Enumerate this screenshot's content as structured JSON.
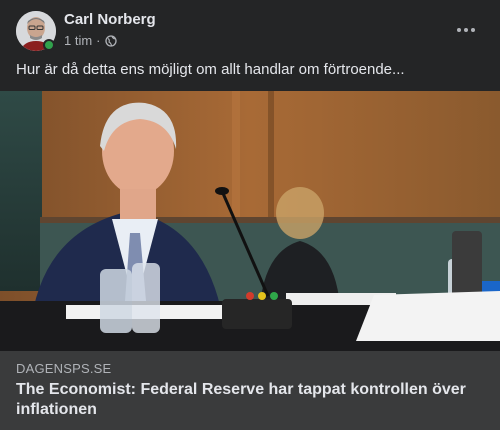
{
  "post": {
    "author": "Carl Norberg",
    "time": "1 tim",
    "separator": "·",
    "text": "Hur är då detta ens möjligt om allt handlar om förtroende..."
  },
  "link": {
    "domain": "DAGENSPS.SE",
    "title": "The Economist: Federal Reserve har tappat kontrollen över inflationen"
  },
  "icons": {
    "audience": "globe-icon",
    "more": "more-options-icon",
    "presence": "online-status-dot"
  },
  "colors": {
    "background": "#242526",
    "preview_background": "#3a3b3c",
    "online": "#31a24c",
    "secondary_text": "#b0b3b8"
  }
}
